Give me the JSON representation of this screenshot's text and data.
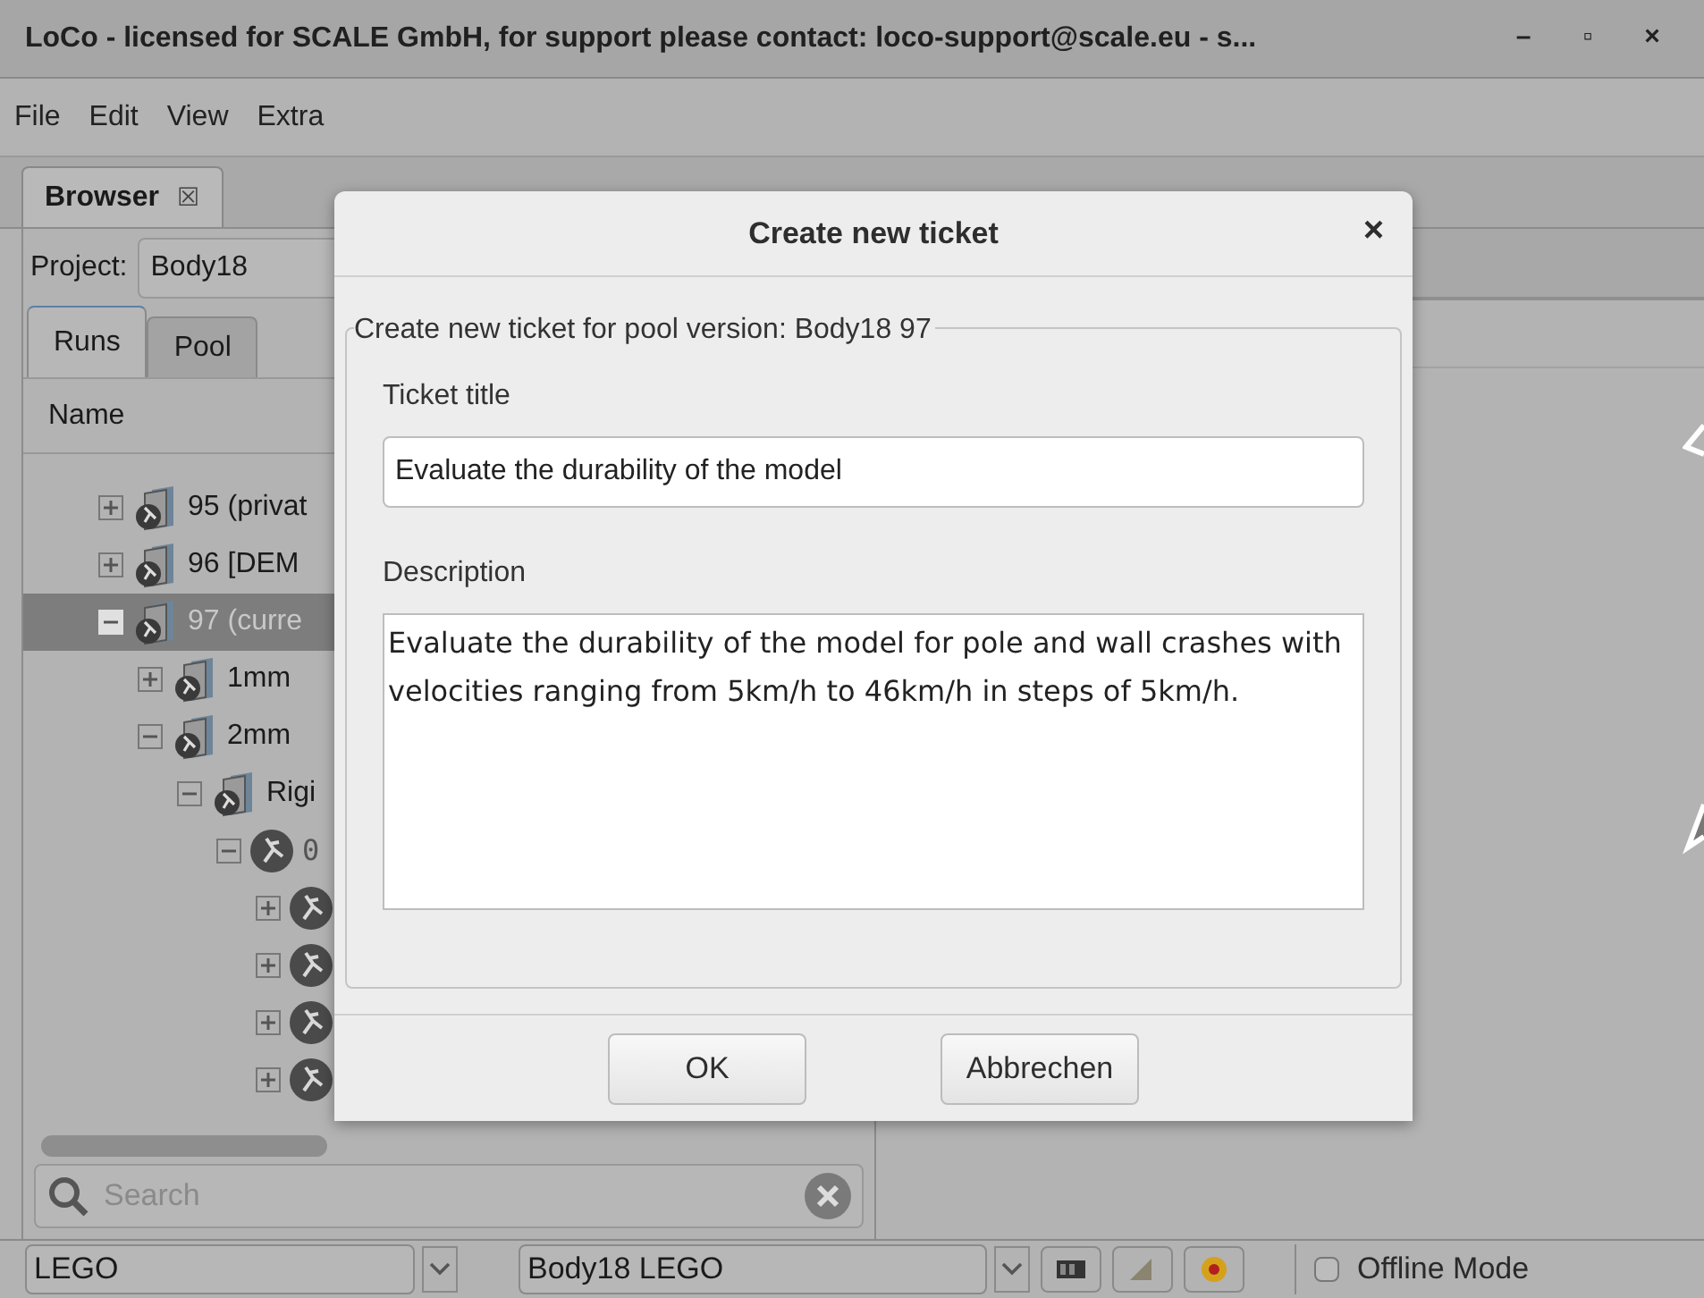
{
  "window": {
    "title": "LoCo - licensed for SCALE GmbH, for support please contact: loco-support@scale.eu - s...",
    "controls": [
      "–",
      "▫",
      "×"
    ]
  },
  "menu": [
    "File",
    "Edit",
    "View",
    "Extra"
  ],
  "tabs": [
    {
      "label": "Browser",
      "selected": true,
      "close": "☒"
    }
  ],
  "browser": {
    "project_label": "Project:",
    "project": "Body18",
    "tabs": [
      {
        "label": "Runs",
        "selected": true
      },
      {
        "label": "Pool",
        "selected": false
      }
    ],
    "column": "Name",
    "tree": [
      {
        "label": "95 (privat",
        "kind": "folder",
        "expanded": false,
        "selected": false
      },
      {
        "label": "96 [DEM",
        "kind": "folder",
        "expanded": false,
        "selected": false
      },
      {
        "label": "97 (curre",
        "kind": "folder",
        "expanded": true,
        "selected": true,
        "children": [
          {
            "label": "1mm",
            "kind": "folder",
            "expanded": false,
            "selected": false
          },
          {
            "label": "2mm",
            "kind": "folder",
            "expanded": true,
            "selected": false,
            "children": [
              {
                "label": "Rigi",
                "kind": "folder",
                "expanded": true,
                "selected": false,
                "children": [
                  {
                    "label": "0",
                    "kind": "run",
                    "expanded": true,
                    "selected": false,
                    "children": [
                      {
                        "kind": "run",
                        "expanded": false,
                        "selected": false
                      },
                      {
                        "kind": "run",
                        "expanded": false,
                        "selected": false
                      },
                      {
                        "kind": "run",
                        "expanded": false,
                        "selected": false
                      },
                      {
                        "kind": "run",
                        "expanded": false,
                        "selected": false
                      }
                    ]
                  }
                ]
              }
            ]
          }
        ]
      }
    ],
    "search": {
      "placeholder": "Search"
    }
  },
  "status_bar": {
    "left_combo": "LEGO",
    "right_combo": "Body18 LEGO",
    "offline": {
      "label": "Offline Mode",
      "checked": false
    }
  },
  "dialog": {
    "title": "Create new ticket",
    "close": "×",
    "group": "Create new ticket for pool version: Body18 97",
    "title_label": "Ticket title",
    "title_value": "Evaluate the durability of the model",
    "description_label": "Description",
    "description_value": "Evaluate the durability of the model for pole and wall crashes with velocities ranging from 5km/h to 46km/h in steps of 5km/h.",
    "buttons": [
      "OK",
      "Abbrechen"
    ]
  }
}
